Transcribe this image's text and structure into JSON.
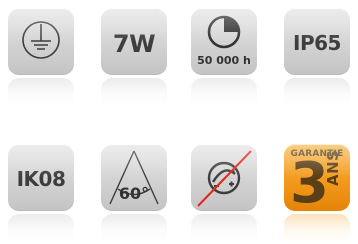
{
  "icons": {
    "earth": {
      "icon": "earth-ground-icon"
    },
    "power": {
      "label": "7W"
    },
    "lifetime": {
      "icon": "clock-icon",
      "label": "50 000 h"
    },
    "ip_rating": {
      "label": "IP65"
    },
    "impact": {
      "label": "IK08"
    },
    "beam_angle": {
      "icon": "beam-angle-icon",
      "label": "60°"
    },
    "no_dimmer": {
      "icon": "dimmer-crossed-icon"
    },
    "warranty": {
      "label": "GARANTIE",
      "number": "3",
      "unit": "ANS"
    }
  },
  "colors": {
    "tile": "#d4d4d4",
    "icon_dark": "#3d3d3d",
    "warranty_orange": "#f29a1d",
    "cross_red": "#e0261b"
  }
}
